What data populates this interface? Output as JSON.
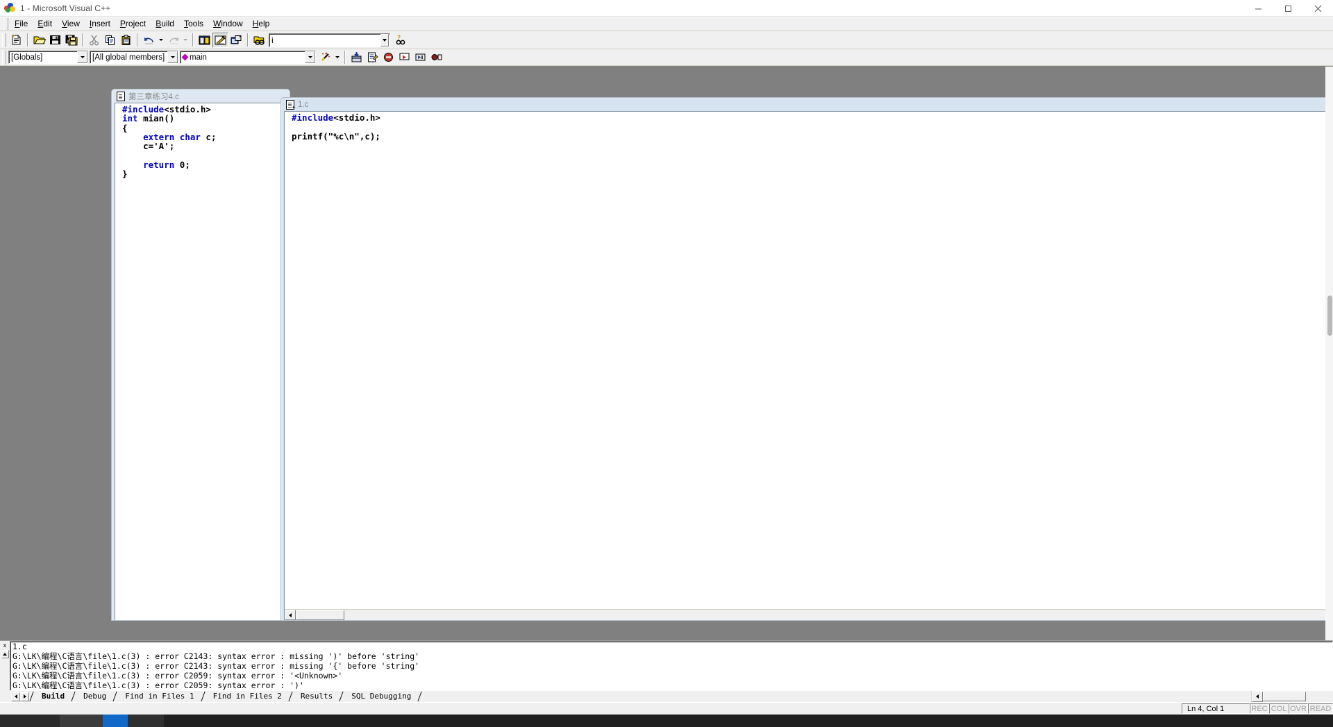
{
  "window": {
    "title": "1 - Microsoft Visual C++",
    "app_icon": "visual-cpp-logo-icon",
    "minimize": "─",
    "maximize": "☐",
    "close": "✕"
  },
  "menubar": {
    "items": [
      {
        "label": "File",
        "accel": "F"
      },
      {
        "label": "Edit",
        "accel": "E"
      },
      {
        "label": "View",
        "accel": "V"
      },
      {
        "label": "Insert",
        "accel": "I"
      },
      {
        "label": "Project",
        "accel": "P"
      },
      {
        "label": "Build",
        "accel": "B"
      },
      {
        "label": "Tools",
        "accel": "T"
      },
      {
        "label": "Window",
        "accel": "W"
      },
      {
        "label": "Help",
        "accel": "H"
      }
    ]
  },
  "standard_toolbar": {
    "buttons": [
      {
        "name": "new-text-file-icon",
        "tip": "New Text File"
      },
      {
        "name": "open-icon",
        "tip": "Open"
      },
      {
        "name": "save-icon",
        "tip": "Save"
      },
      {
        "name": "save-all-icon",
        "tip": "Save All"
      },
      {
        "name": "cut-icon",
        "tip": "Cut"
      },
      {
        "name": "copy-icon",
        "tip": "Copy"
      },
      {
        "name": "paste-icon",
        "tip": "Paste"
      },
      {
        "name": "undo-icon",
        "tip": "Undo"
      },
      {
        "name": "redo-icon",
        "tip": "Redo"
      },
      {
        "name": "workspace-icon",
        "tip": "Workspace"
      },
      {
        "name": "output-window-icon",
        "tip": "Output"
      },
      {
        "name": "window-list-icon",
        "tip": "Window List"
      },
      {
        "name": "find-in-files-icon",
        "tip": "Find in Files"
      },
      {
        "name": "help-search-icon",
        "tip": "Search"
      }
    ],
    "search": {
      "value": "i",
      "placeholder": ""
    }
  },
  "wizardbar": {
    "class_combo": {
      "value": "[Globals]"
    },
    "member_combo": {
      "value": "[All global members]"
    },
    "function_combo": {
      "value": "main",
      "icon": "magenta-diamond-icon"
    },
    "actions_icon": "magic-wand-icon",
    "build_buttons": [
      {
        "name": "compile-icon",
        "tip": "Compile"
      },
      {
        "name": "build-icon",
        "tip": "Build"
      },
      {
        "name": "stop-build-icon",
        "tip": "Stop Build"
      },
      {
        "name": "execute-program-icon",
        "tip": "Execute Program"
      },
      {
        "name": "go-debug-icon",
        "tip": "Go"
      },
      {
        "name": "insert-breakpoint-icon",
        "tip": "Insert/Remove Breakpoint"
      }
    ]
  },
  "editors": [
    {
      "id": "editor-background",
      "title": "第三章练习4.c",
      "icon": "c-source-file-icon",
      "active": false,
      "lines": [
        [
          {
            "t": "#include",
            "c": "pp"
          },
          {
            "t": "<stdio.h>",
            "c": "pln"
          }
        ],
        [
          {
            "t": "int",
            "c": "kw"
          },
          {
            "t": " mian()",
            "c": "pln"
          }
        ],
        [
          {
            "t": "{",
            "c": "pln"
          }
        ],
        [
          {
            "t": "    ",
            "c": "pln"
          },
          {
            "t": "extern char",
            "c": "kw"
          },
          {
            "t": " c;",
            "c": "pln"
          }
        ],
        [
          {
            "t": "    c='A';",
            "c": "pln"
          }
        ],
        [
          {
            "t": "",
            "c": "pln"
          }
        ],
        [
          {
            "t": "    ",
            "c": "pln"
          },
          {
            "t": "return",
            "c": "kw"
          },
          {
            "t": " 0;",
            "c": "pln"
          }
        ],
        [
          {
            "t": "}",
            "c": "pln"
          }
        ]
      ]
    },
    {
      "id": "editor-active",
      "title": "1.c",
      "icon": "c-source-file-icon",
      "active": true,
      "lines": [
        [
          {
            "t": "#include",
            "c": "pp"
          },
          {
            "t": "<stdio.h>",
            "c": "pln"
          }
        ],
        [
          {
            "t": "",
            "c": "pln"
          }
        ],
        [
          {
            "t": "printf(\"%c\\n\",c);",
            "c": "pln"
          }
        ]
      ]
    }
  ],
  "output": {
    "lines": [
      "1.c",
      "G:\\LK\\编程\\C语言\\file\\1.c(3) : error C2143: syntax error : missing ')' before 'string'",
      "G:\\LK\\编程\\C语言\\file\\1.c(3) : error C2143: syntax error : missing '{' before 'string'",
      "G:\\LK\\编程\\C语言\\file\\1.c(3) : error C2059: syntax error : '<Unknown>'",
      "G:\\LK\\编程\\C语言\\file\\1.c(3) : error C2059: syntax error : ')'"
    ],
    "close_label": "x",
    "tabs": [
      {
        "label": "Build",
        "active": true
      },
      {
        "label": "Debug",
        "active": false
      },
      {
        "label": "Find in Files 1",
        "active": false
      },
      {
        "label": "Find in Files 2",
        "active": false
      },
      {
        "label": "Results",
        "active": false
      },
      {
        "label": "SQL Debugging",
        "active": false
      }
    ]
  },
  "statusbar": {
    "message": "",
    "position": "Ln 4, Col 1",
    "indicators": [
      {
        "label": "REC",
        "dim": true
      },
      {
        "label": "COL",
        "dim": true
      },
      {
        "label": "OVR",
        "dim": true
      },
      {
        "label": "READ",
        "dim": true
      }
    ]
  }
}
